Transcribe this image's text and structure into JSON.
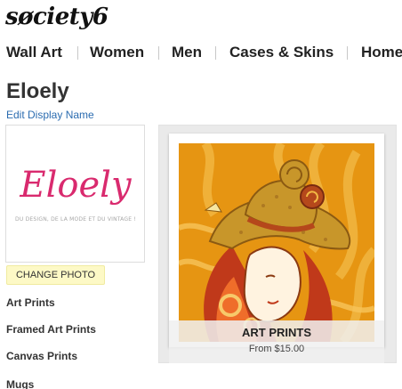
{
  "brand": {
    "logo_text": "søciety6"
  },
  "nav": {
    "items": [
      {
        "label": "Wall Art"
      },
      {
        "label": "Women"
      },
      {
        "label": "Men"
      },
      {
        "label": "Cases & Skins"
      },
      {
        "label": "Home"
      }
    ]
  },
  "profile": {
    "name": "Eloely",
    "edit_link": "Edit Display Name",
    "avatar": {
      "logo_text": "Eloely",
      "tagline": "DU DESIGN, DE LA MODE ET DU VINTAGE !"
    },
    "change_photo_label": "CHANGE PHOTO"
  },
  "sidebar": {
    "links": [
      {
        "label": "Art Prints"
      },
      {
        "label": "Framed Art Prints"
      },
      {
        "label": "Canvas Prints"
      },
      {
        "label": "Mugs"
      }
    ]
  },
  "product": {
    "title": "ART PRINTS",
    "price": "From $15.00"
  },
  "colors": {
    "link_blue": "#2b6cb0",
    "change_photo_bg": "#fdf9c6",
    "avatar_logo_pink": "#d92a6e",
    "art_orange": "#e69512"
  }
}
